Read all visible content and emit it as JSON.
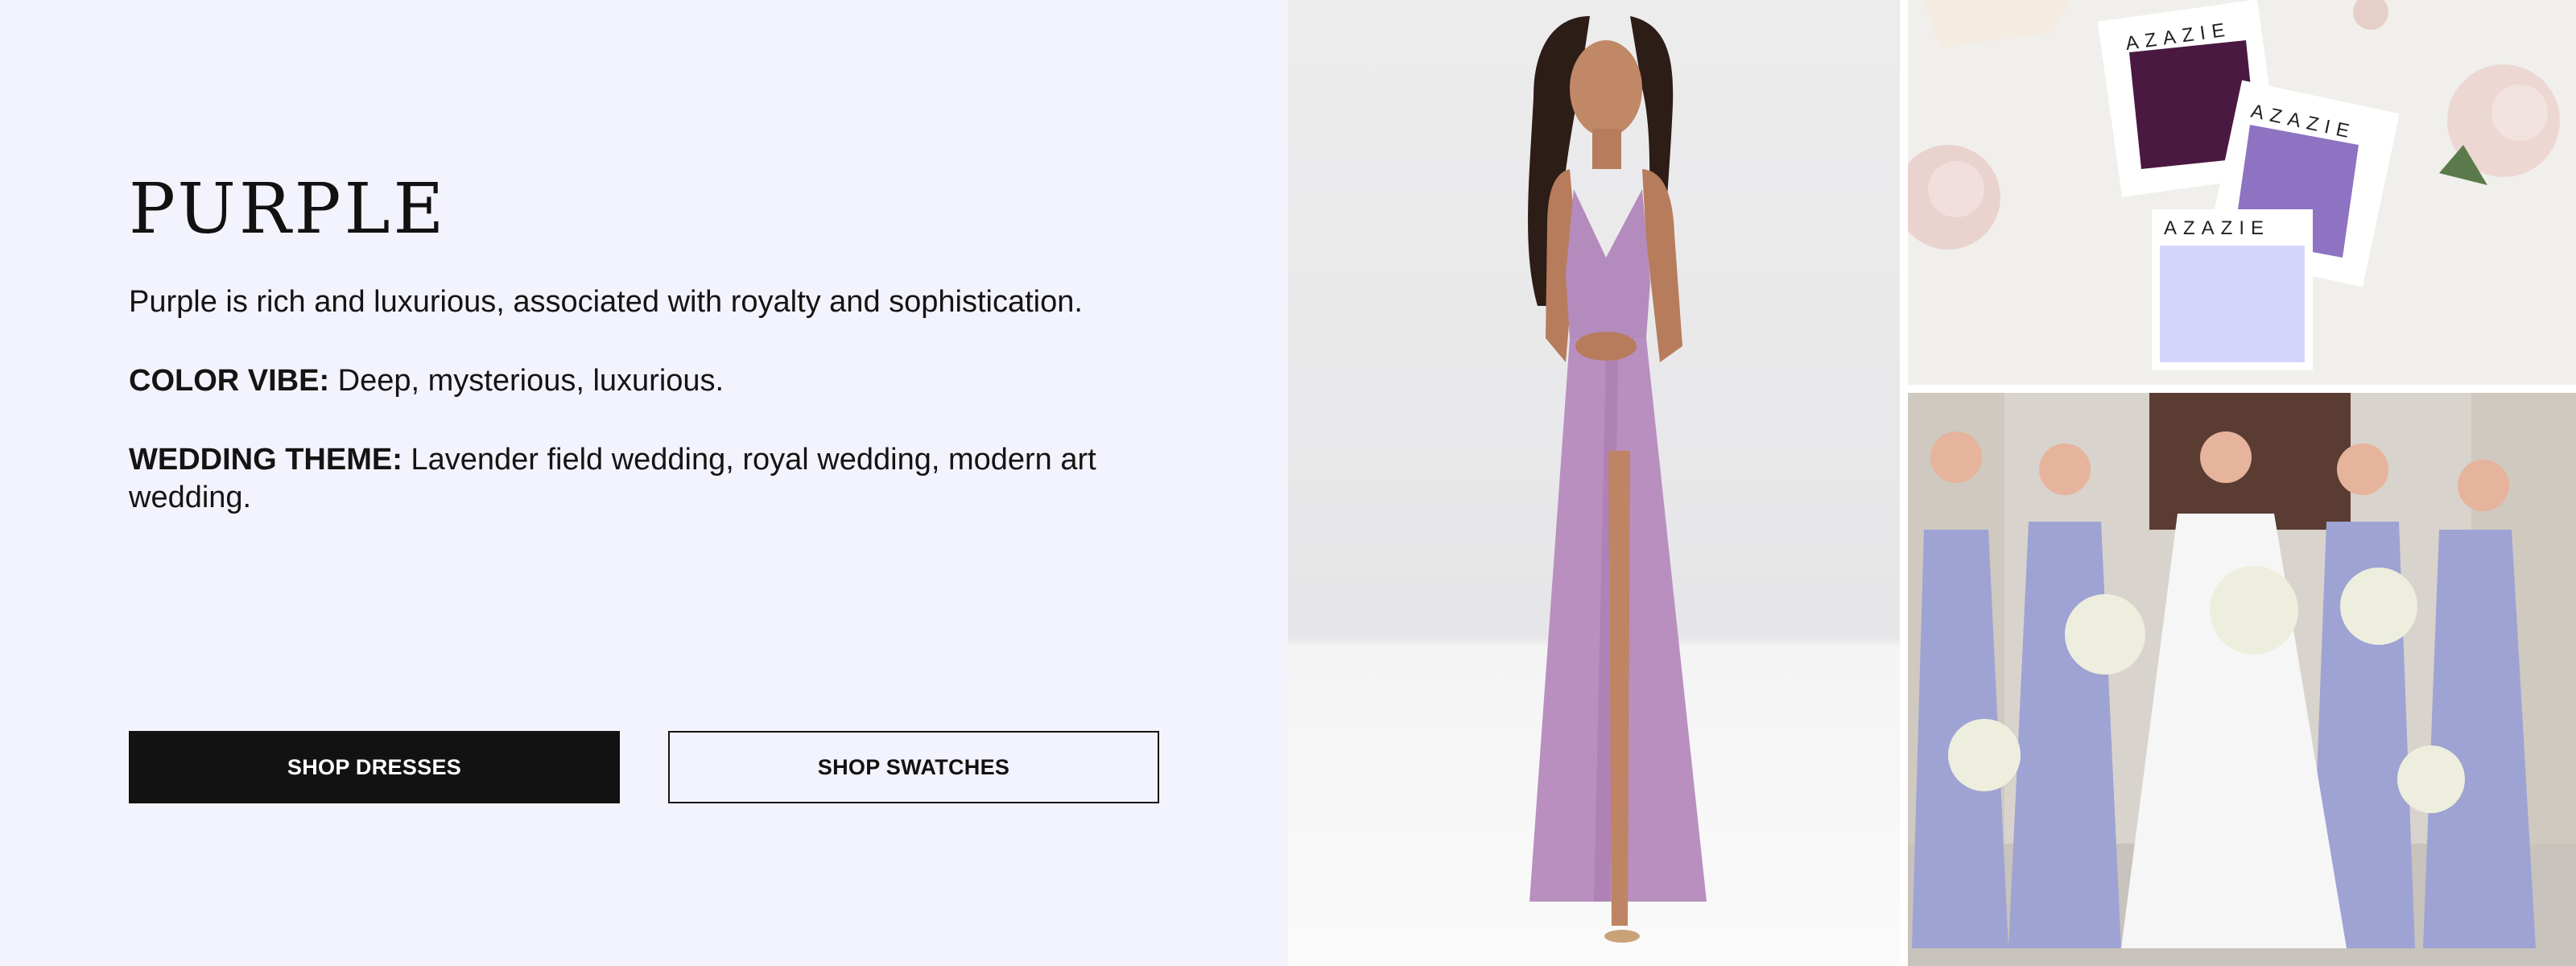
{
  "hero": {
    "title": "PURPLE",
    "description": "Purple is rich and luxurious, associated with royalty and sophistication.",
    "color_vibe_label": "COLOR VIBE:",
    "color_vibe_value": " Deep, mysterious, luxurious.",
    "wedding_theme_label": "WEDDING THEME:",
    "wedding_theme_value": " Lavender field wedding, royal wedding, modern art wedding."
  },
  "buttons": {
    "shop_dresses": "SHOP DRESSES",
    "shop_swatches": "SHOP SWATCHES"
  },
  "swatches": {
    "brand_1": "AZAZIE",
    "brand_2": "AZAZIE",
    "brand_3": "AZAZIE"
  },
  "colors": {
    "background": "#f3f3fd",
    "primary_button": "#121212",
    "dress": "#b98fc0",
    "swatch_dark": "#4a1942",
    "swatch_mid": "#8e73c2",
    "swatch_light": "#d5d5fb",
    "bridesmaid": "#9ea3d3"
  }
}
